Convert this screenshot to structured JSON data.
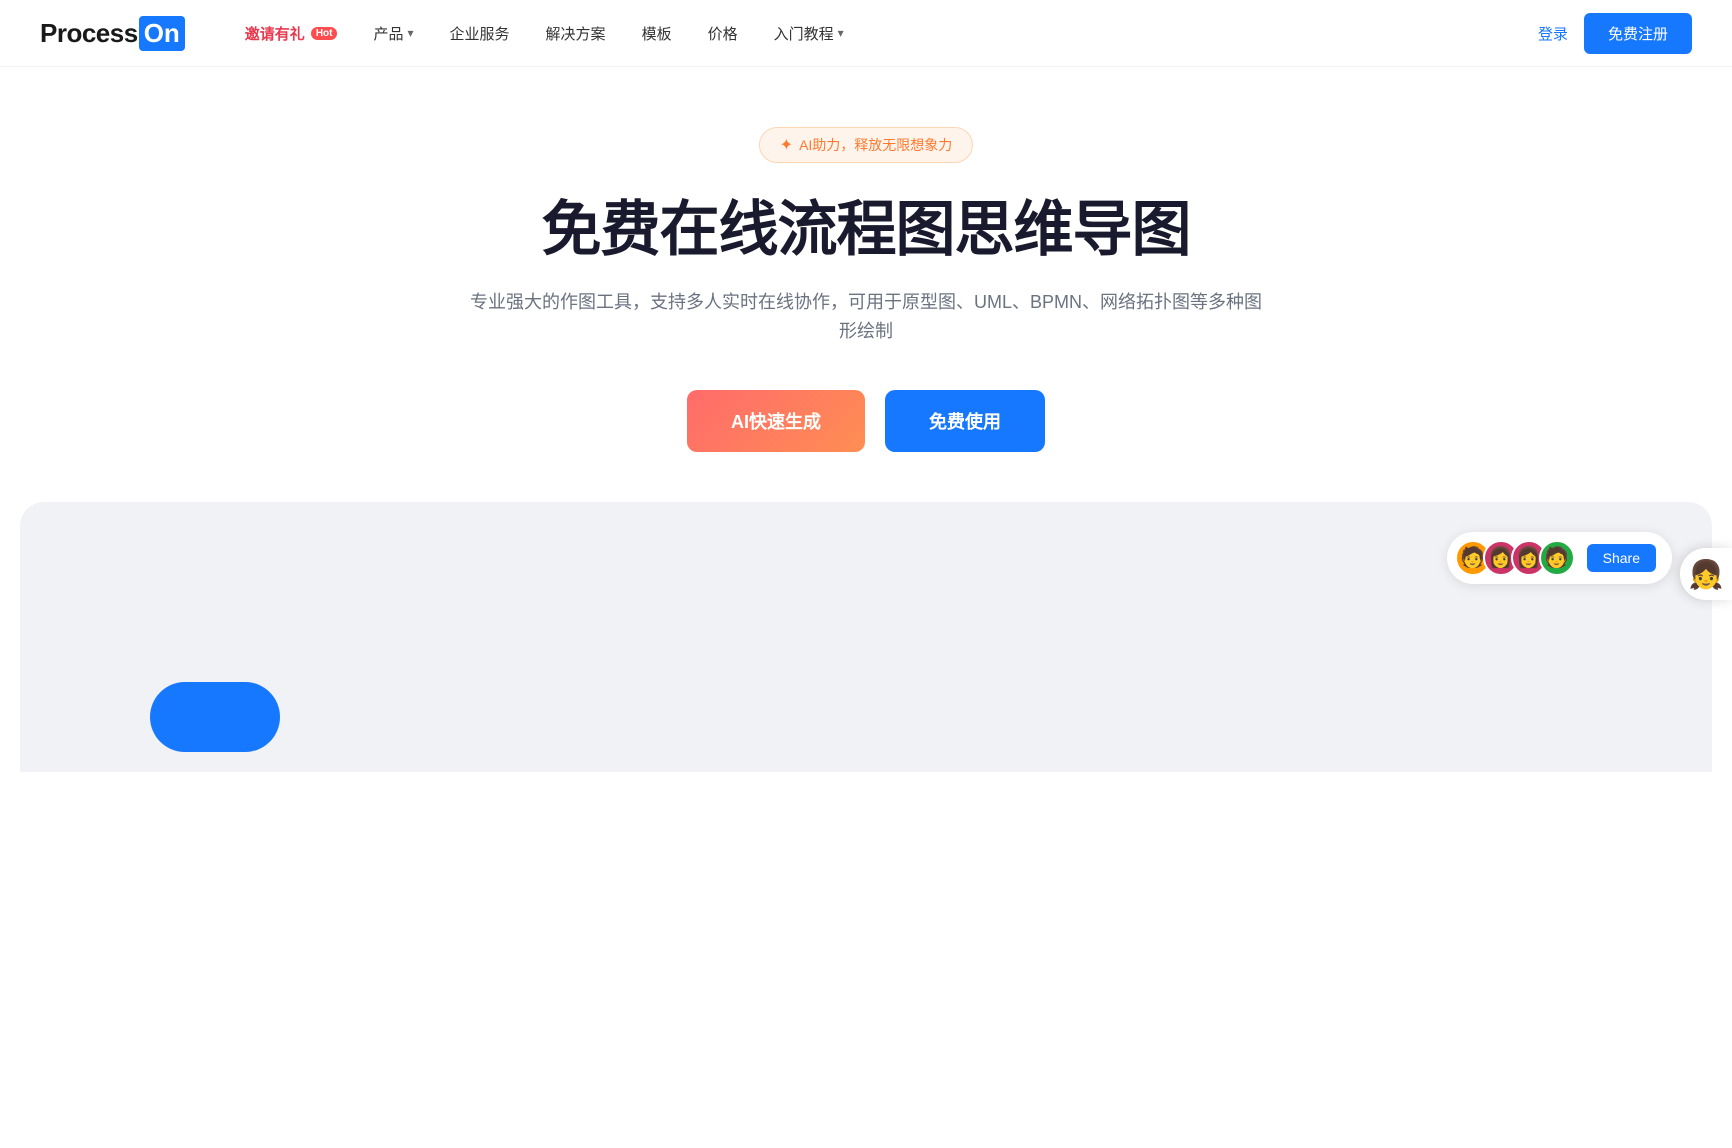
{
  "logo": {
    "text_process": "Process",
    "text_on": "On"
  },
  "nav": {
    "invite_label": "邀请有礼",
    "hot_badge": "Hot",
    "product_label": "产品",
    "enterprise_label": "企业服务",
    "solutions_label": "解决方案",
    "templates_label": "模板",
    "price_label": "价格",
    "tutorial_label": "入门教程",
    "login_label": "登录",
    "register_label": "免费注册"
  },
  "hero": {
    "ai_badge": "AI助力，释放无限想象力",
    "title": "免费在线流程图思维导图",
    "subtitle": "专业强大的作图工具，支持多人实时在线协作，可用于原型图、UML、BPMN、网络拓扑图等多种图形绘制",
    "btn_ai": "AI快速生成",
    "btn_free": "免费使用"
  },
  "demo": {
    "share_btn": "Share",
    "avatars": [
      "🧑",
      "👩",
      "👩",
      "🧑"
    ]
  },
  "float": {
    "avatar": "👧"
  }
}
